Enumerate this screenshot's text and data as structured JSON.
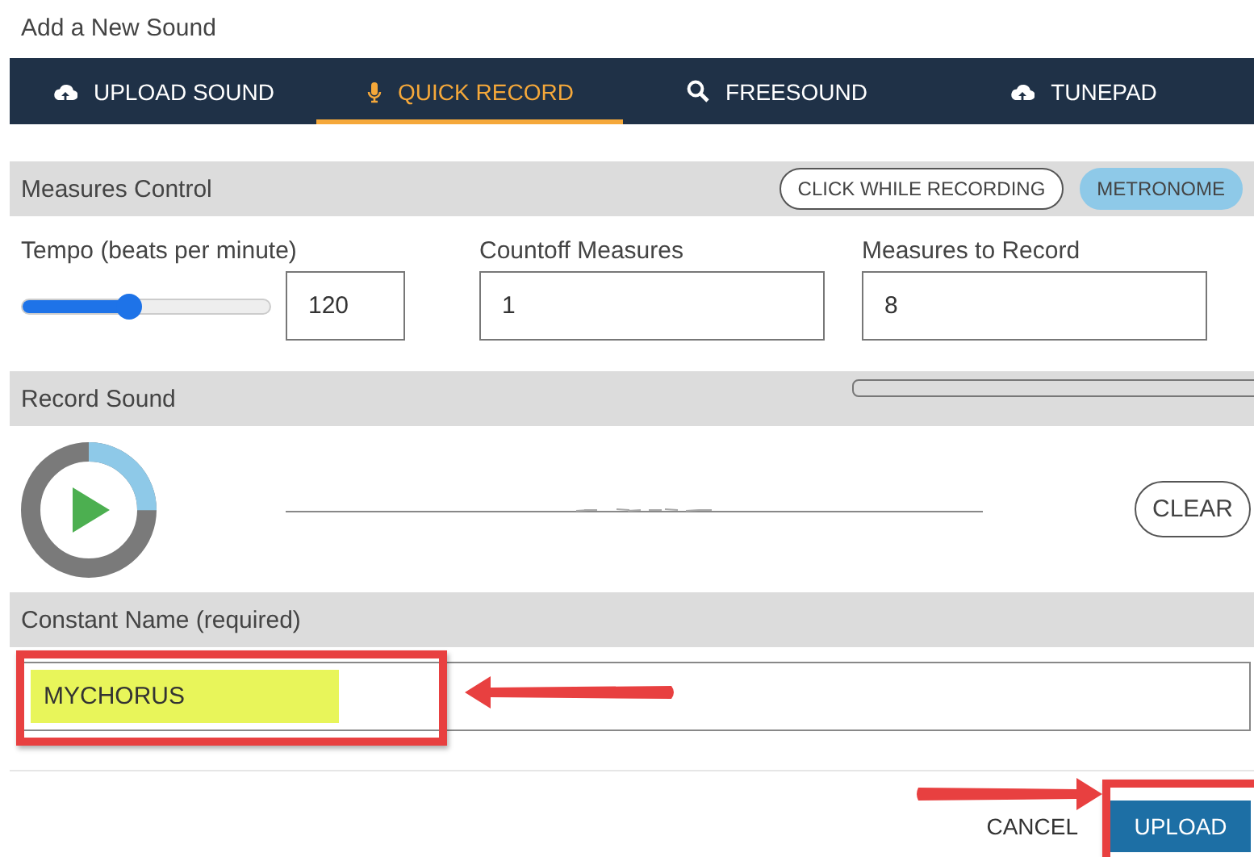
{
  "window": {
    "title": "Add a New Sound"
  },
  "tabs": [
    {
      "label": "UPLOAD SOUND",
      "kind": "upload",
      "selected": false
    },
    {
      "label": "QUICK RECORD",
      "kind": "record",
      "selected": true
    },
    {
      "label": "FREESOUND",
      "kind": "search",
      "selected": false
    },
    {
      "label": "TUNEPAD",
      "kind": "upload",
      "selected": false
    }
  ],
  "measures": {
    "title": "Measures Control",
    "toggles": [
      {
        "label": "CLICK WHILE RECORDING",
        "on": false
      },
      {
        "label": "METRONOME",
        "on": true
      }
    ],
    "fields": [
      {
        "label": "Tempo (beats per minute)",
        "value": "120",
        "kind": "slider",
        "level": 0.43
      },
      {
        "label": "Countoff Measures",
        "value": "1",
        "kind": "text"
      },
      {
        "label": "Measures to Record",
        "value": "8",
        "kind": "text"
      }
    ]
  },
  "record": {
    "title": "Record Sound",
    "level": 0.25,
    "clear": "CLEAR"
  },
  "name": {
    "title": "Constant Name (required)",
    "value": "MYCHORUS"
  },
  "buttons": [
    {
      "label": "CANCEL",
      "kind": "flat"
    },
    {
      "label": "UPLOAD",
      "kind": "primary"
    }
  ]
}
